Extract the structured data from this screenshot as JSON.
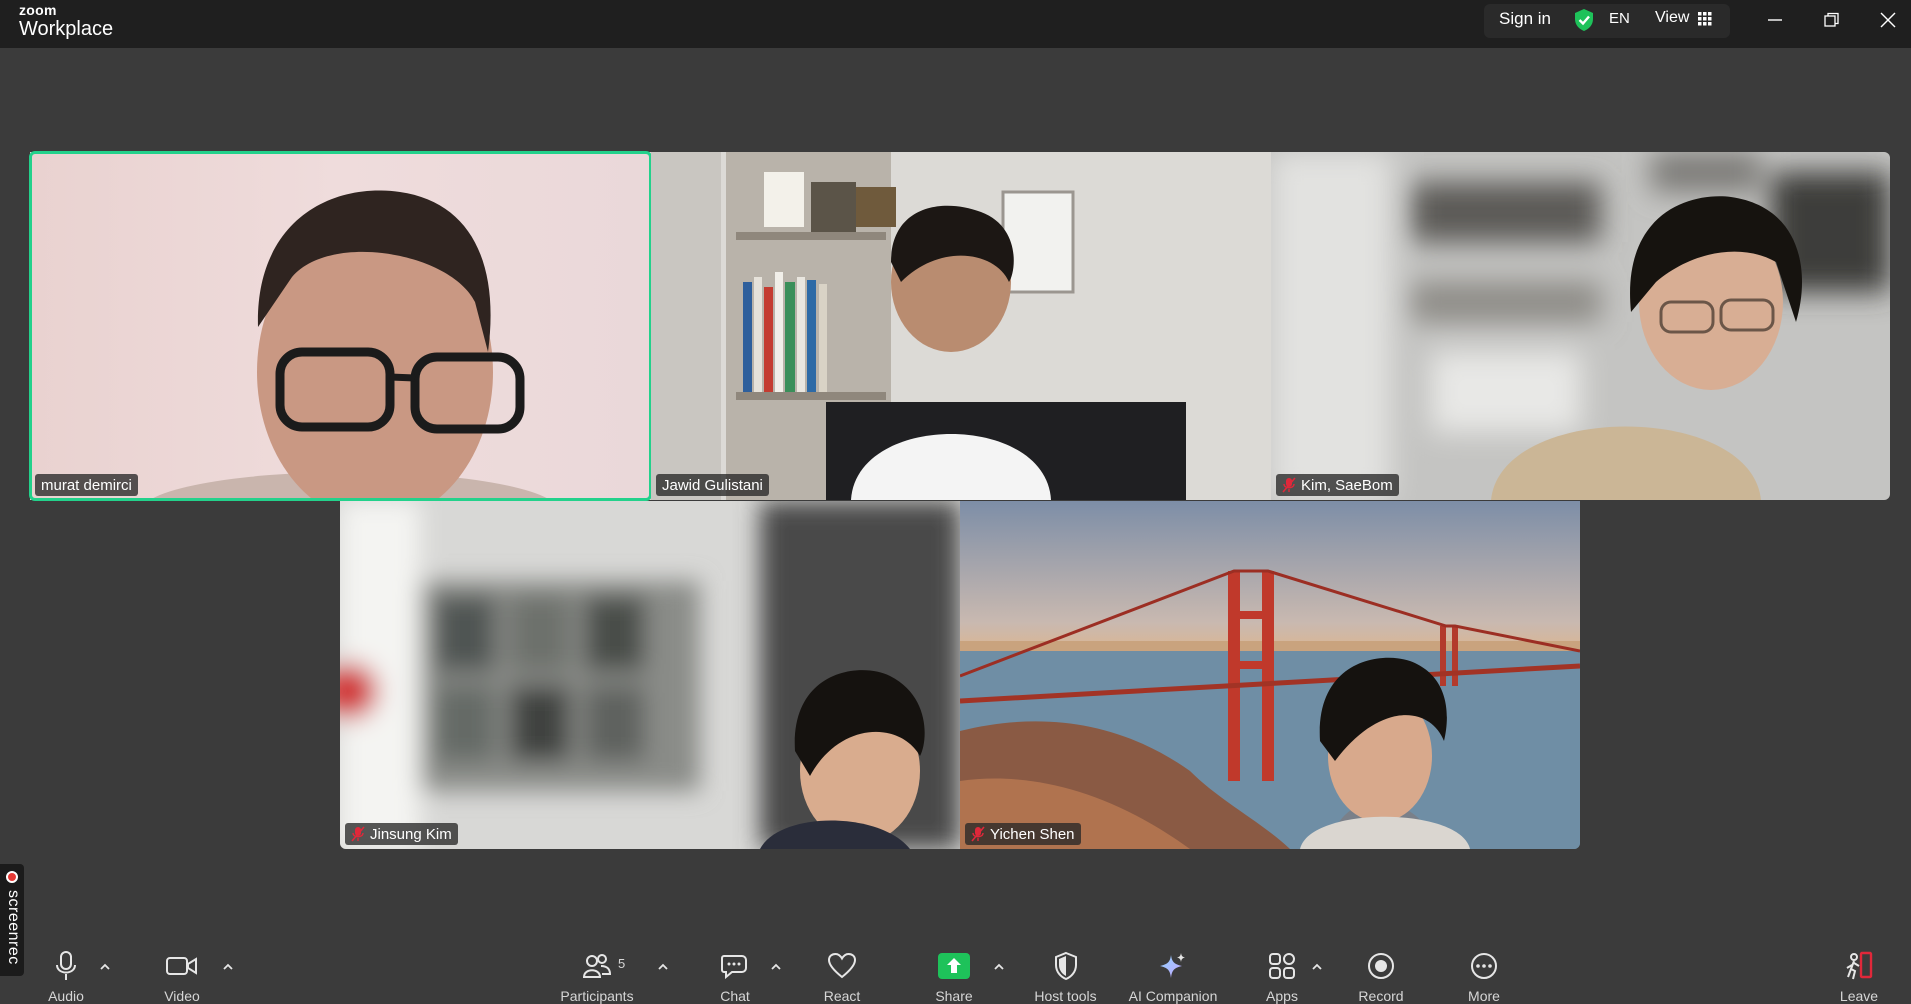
{
  "app": {
    "brand_small": "zoom",
    "brand_name": "Workplace"
  },
  "titlebar": {
    "sign_in": "Sign in",
    "language": "EN",
    "view": "View"
  },
  "participants": [
    {
      "name": "murat demirci",
      "muted": false,
      "speaking": true
    },
    {
      "name": "Jawid Gulistani",
      "muted": false,
      "speaking": false
    },
    {
      "name": "Kim, SaeBom",
      "muted": true,
      "speaking": false
    },
    {
      "name": "Jinsung Kim",
      "muted": true,
      "speaking": false
    },
    {
      "name": "Yichen Shen",
      "muted": true,
      "speaking": false
    }
  ],
  "recorder": {
    "label": "screenrec"
  },
  "toolbar": {
    "audio": "Audio",
    "video": "Video",
    "participants": "Participants",
    "participant_count": "5",
    "chat": "Chat",
    "react": "React",
    "share": "Share",
    "host_tools": "Host tools",
    "ai_companion": "AI Companion",
    "apps": "Apps",
    "record": "Record",
    "more": "More",
    "leave": "Leave"
  },
  "colors": {
    "active_speaker": "#23d18b",
    "share_green": "#1ec25a",
    "leave_red": "#e0283a",
    "background": "#3b3b3b",
    "titlebar": "#1f1f1f"
  },
  "icons": [
    "shield-check-icon",
    "grid-icon",
    "microphone-icon",
    "video-camera-icon",
    "participants-icon",
    "chat-icon",
    "heart-icon",
    "share-arrow-icon",
    "host-shield-icon",
    "sparkle-icon",
    "apps-icon",
    "record-icon",
    "more-dots-icon",
    "leave-icon",
    "muted-mic-icon"
  ]
}
